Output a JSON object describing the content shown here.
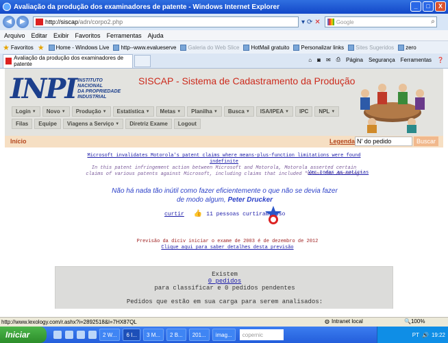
{
  "window": {
    "title": "Avaliação da produção dos examinadores de patente - Windows Internet Explorer",
    "controls": [
      "_",
      "□",
      "X"
    ]
  },
  "address_bar": {
    "url_host": "http://siscap",
    "url_path": "/adn/corpo2.php",
    "search_placeholder": "Google"
  },
  "menu": [
    "Arquivo",
    "Editar",
    "Exibir",
    "Favoritos",
    "Ferramentas",
    "Ajuda"
  ],
  "favorites_bar": {
    "label": "Favoritos",
    "items": [
      {
        "label": "Home - Windows Live",
        "dim": false
      },
      {
        "label": "http--www.evalueserve",
        "dim": false
      },
      {
        "label": "Galeria do Web Slice",
        "dim": true
      },
      {
        "label": "HotMail gratuito",
        "dim": false
      },
      {
        "label": "Personalizar links",
        "dim": false
      },
      {
        "label": "Sites Sugeridos",
        "dim": true
      },
      {
        "label": "zero",
        "dim": false
      }
    ]
  },
  "tab": {
    "label": "Avaliação da produção dos examinadores de patente"
  },
  "command_bar": [
    "Página",
    "Segurança",
    "Ferramentas"
  ],
  "site": {
    "logo_text": "INPI",
    "logo_subtitle_lines": [
      "INSTITUTO",
      "NACIONAL",
      "DA PROPRIEDADE",
      "INDUSTRIAL"
    ],
    "title": "SISCAP - Sistema de Cadastramento da Produção",
    "nav_row1": [
      {
        "label": "Login",
        "has_caret": true
      },
      {
        "label": "Novo",
        "has_caret": true
      },
      {
        "label": "Produção",
        "has_caret": true
      },
      {
        "label": "Estatística",
        "has_caret": true
      },
      {
        "label": "Metas",
        "has_caret": true
      },
      {
        "label": "Planilha",
        "has_caret": true
      },
      {
        "label": "Busca",
        "has_caret": true
      },
      {
        "label": "ISA/IPEA",
        "has_caret": true
      },
      {
        "label": "IPC",
        "has_caret": false
      },
      {
        "label": "NPL",
        "has_caret": true
      }
    ],
    "nav_row2": [
      {
        "label": "Filas",
        "has_caret": false
      },
      {
        "label": "Equipe",
        "has_caret": false
      },
      {
        "label": "Viagens a Serviço",
        "has_caret": true
      },
      {
        "label": "Diretriz Exame",
        "has_caret": false
      },
      {
        "label": "Logout",
        "has_caret": false
      }
    ],
    "breadcrumb": "Início",
    "legenda": "Legenda",
    "search_value": "N' do pedido",
    "search_button": "Buscar",
    "news": {
      "title": "Microsoft invalidates Motorola's patent claims where means-plus-function limitations were found indefinite",
      "description": "In this patent infringement action between Microsoft and Motorola, Motorola asserted certain claims of various patents against Microsoft, including claims that included \"means for decoding\"",
      "more_link": "Ver todas as notícias"
    },
    "quote": {
      "text": "Não há nada tão inútil como fazer eficientemente o que não se devia fazer de modo algum,",
      "author": "Peter Drucker"
    },
    "likes": {
      "curtir": "curtir",
      "count_text": "11 pessoas curtiram isso"
    },
    "previsao": {
      "text": "Previsão da diciv iniciar o exame de 2003 é de dezembro de 2012",
      "link": "Clique aqui para saber detalhes desta previsão"
    },
    "panel": {
      "existem": "Existem",
      "pedidos_link": "0 pedidos",
      "classificar": "para classificar e 0 pedidos pendentes",
      "carga": "Pedidos que estão em sua carga para serem analisados:"
    }
  },
  "status_bar": {
    "url": "http://www.lexology.com/r.ashx?i=2892518&l=7HX87QL",
    "zone": "Intranet local",
    "zoom": "100%"
  },
  "taskbar": {
    "start": "Iniciar",
    "buttons": [
      "2 W...",
      "6 I...",
      "3 M...",
      "2 B...",
      "201...",
      "imag..."
    ],
    "copernic": "copernic",
    "tray_lang": "PT",
    "clock": "19:22"
  },
  "colors": {
    "ie_title": "#1348c8",
    "site_title": "#cc2a1c",
    "inpi_blue": "#1c3f8c",
    "accent_orange": "#b4461e",
    "link_blue": "#1a1aa8"
  }
}
